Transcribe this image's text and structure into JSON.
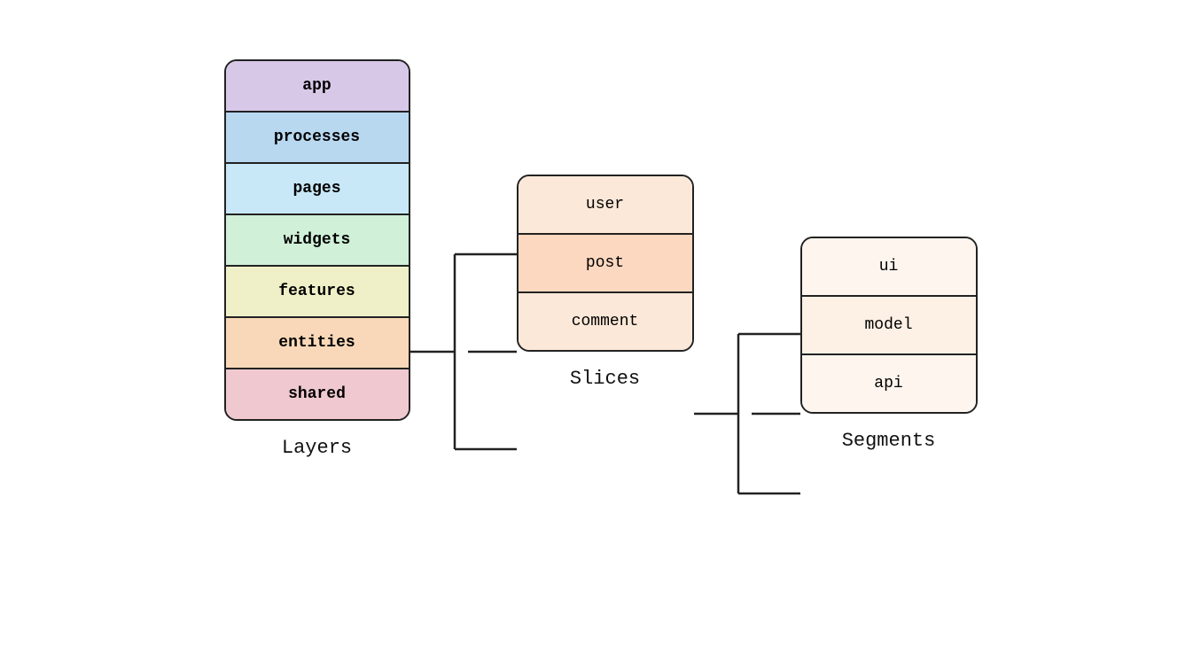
{
  "layers": {
    "label": "Layers",
    "items": [
      {
        "id": "app",
        "label": "app",
        "class": "layer-app"
      },
      {
        "id": "processes",
        "label": "processes",
        "class": "layer-processes"
      },
      {
        "id": "pages",
        "label": "pages",
        "class": "layer-pages"
      },
      {
        "id": "widgets",
        "label": "widgets",
        "class": "layer-widgets"
      },
      {
        "id": "features",
        "label": "features",
        "class": "layer-features"
      },
      {
        "id": "entities",
        "label": "entities",
        "class": "layer-entities"
      },
      {
        "id": "shared",
        "label": "shared",
        "class": "layer-shared"
      }
    ]
  },
  "slices": {
    "label": "Slices",
    "items": [
      {
        "id": "user",
        "label": "user",
        "class": "slice-user"
      },
      {
        "id": "post",
        "label": "post",
        "class": "slice-post"
      },
      {
        "id": "comment",
        "label": "comment",
        "class": "slice-comment"
      }
    ]
  },
  "segments": {
    "label": "Segments",
    "items": [
      {
        "id": "ui",
        "label": "ui",
        "class": "segment-ui"
      },
      {
        "id": "model",
        "label": "model",
        "class": "segment-model"
      },
      {
        "id": "api",
        "label": "api",
        "class": "segment-api"
      }
    ]
  }
}
